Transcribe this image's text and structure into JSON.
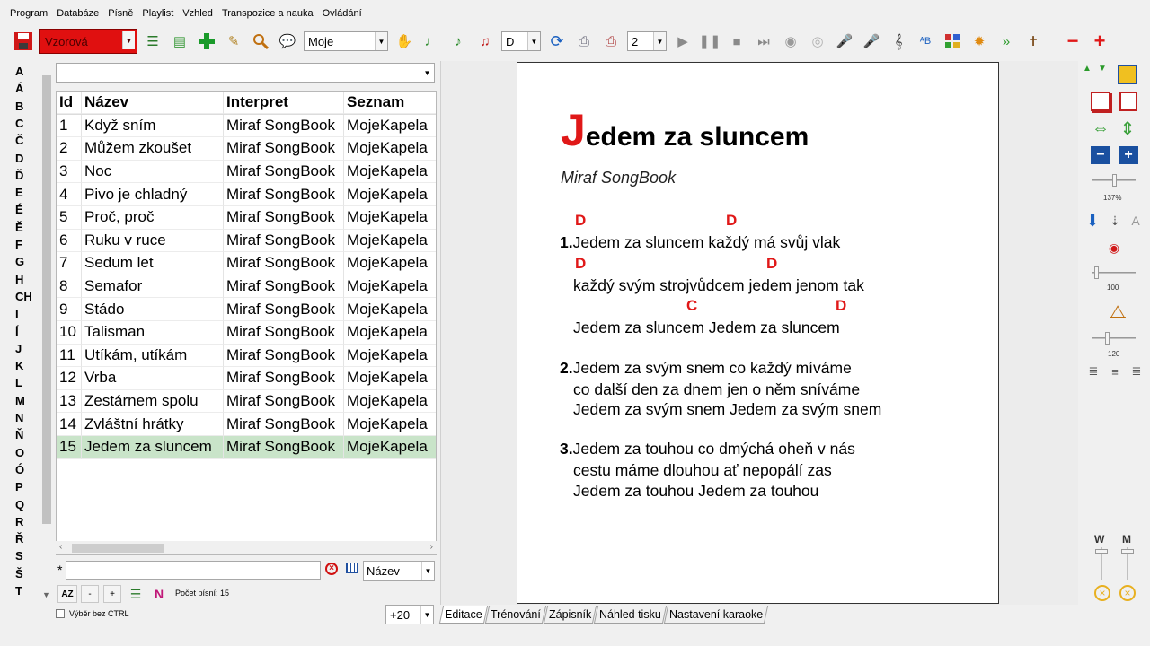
{
  "menu": [
    "Program",
    "Databáze",
    "Písně",
    "Playlist",
    "Vzhled",
    "Transpozice a nauka",
    "Ovládání"
  ],
  "toolbar": {
    "style_select": "Vzorová",
    "songbook_select": "Moje",
    "key_select": "D",
    "columns_select": "2"
  },
  "alphabet": [
    "A",
    "Á",
    "B",
    "C",
    "Č",
    "D",
    "Ď",
    "E",
    "É",
    "Ě",
    "F",
    "G",
    "H",
    "CH",
    "I",
    "Í",
    "J",
    "K",
    "L",
    "M",
    "N",
    "Ň",
    "O",
    "Ó",
    "P",
    "Q",
    "R",
    "Ř",
    "S",
    "Š",
    "T"
  ],
  "filter": {
    "value": ""
  },
  "table": {
    "headers": {
      "id": "Id",
      "name": "Název",
      "interpret": "Interpret",
      "list": "Seznam"
    },
    "rows": [
      {
        "id": "1",
        "name": "Když sním",
        "interpret": "Miraf SongBook",
        "list": "MojeKapela"
      },
      {
        "id": "2",
        "name": "Můžem zkoušet",
        "interpret": "Miraf SongBook",
        "list": "MojeKapela"
      },
      {
        "id": "3",
        "name": "Noc",
        "interpret": "Miraf SongBook",
        "list": "MojeKapela"
      },
      {
        "id": "4",
        "name": "Pivo je chladný",
        "interpret": "Miraf SongBook",
        "list": "MojeKapela"
      },
      {
        "id": "5",
        "name": "Proč, proč",
        "interpret": "Miraf SongBook",
        "list": "MojeKapela"
      },
      {
        "id": "6",
        "name": "Ruku v ruce",
        "interpret": "Miraf SongBook",
        "list": "MojeKapela"
      },
      {
        "id": "7",
        "name": "Sedum let",
        "interpret": "Miraf SongBook",
        "list": "MojeKapela"
      },
      {
        "id": "8",
        "name": "Semafor",
        "interpret": "Miraf SongBook",
        "list": "MojeKapela"
      },
      {
        "id": "9",
        "name": "Stádo",
        "interpret": "Miraf SongBook",
        "list": "MojeKapela"
      },
      {
        "id": "10",
        "name": "Talisman",
        "interpret": "Miraf SongBook",
        "list": "MojeKapela"
      },
      {
        "id": "11",
        "name": "Utíkám, utíkám",
        "interpret": "Miraf SongBook",
        "list": "MojeKapela"
      },
      {
        "id": "12",
        "name": "Vrba",
        "interpret": "Miraf SongBook",
        "list": "MojeKapela"
      },
      {
        "id": "13",
        "name": "Zestárnem spolu",
        "interpret": "Miraf SongBook",
        "list": "MojeKapela"
      },
      {
        "id": "14",
        "name": "Zvláštní hrátky",
        "interpret": "Miraf SongBook",
        "list": "MojeKapela"
      },
      {
        "id": "15",
        "name": "Jedem za sluncem",
        "interpret": "Miraf SongBook",
        "list": "MojeKapela"
      }
    ],
    "selected_id": "15"
  },
  "search": {
    "prefix": "*",
    "value": "",
    "sort": "Název"
  },
  "bottom": {
    "az_label": "AZ",
    "minus_label": "-",
    "plus_label": "+",
    "count_label": "Počet písní: 15",
    "checkbox_label": "Výběr bez CTRL"
  },
  "song": {
    "title_first": "J",
    "title_rest": "edem za sluncem",
    "author": "Miraf SongBook",
    "chord_name_d": "D",
    "chord_name_c": "C",
    "verses": [
      {
        "number": "1.",
        "lines": [
          "Jedem za sluncem každý má svůj vlak",
          "každý svým strojvůdcem jedem jenom tak",
          "Jedem za sluncem Jedem za sluncem"
        ]
      },
      {
        "number": "2.",
        "lines": [
          "Jedem za svým snem co každý míváme",
          "co další den za dnem jen o něm sníváme",
          "Jedem za svým snem Jedem za svým snem"
        ]
      },
      {
        "number": "3.",
        "lines": [
          "Jedem za touhou co dmýchá oheň v nás",
          "cestu máme dlouhou ať nepopálí zas",
          "Jedem za touhou Jedem za touhou"
        ]
      }
    ]
  },
  "zoom": {
    "value": "+20"
  },
  "tabs": [
    "Editace",
    "Trénování",
    "Zápisník",
    "Náhled tisku",
    "Nastavení karaoke"
  ],
  "right_panel": {
    "zoom_percent": "137%",
    "volume_value": "100",
    "tempo_value": "120",
    "w_label": "W",
    "m_label": "M"
  },
  "colors": {
    "accent_red": "#e01818",
    "selected_row": "#c9e4c9"
  }
}
